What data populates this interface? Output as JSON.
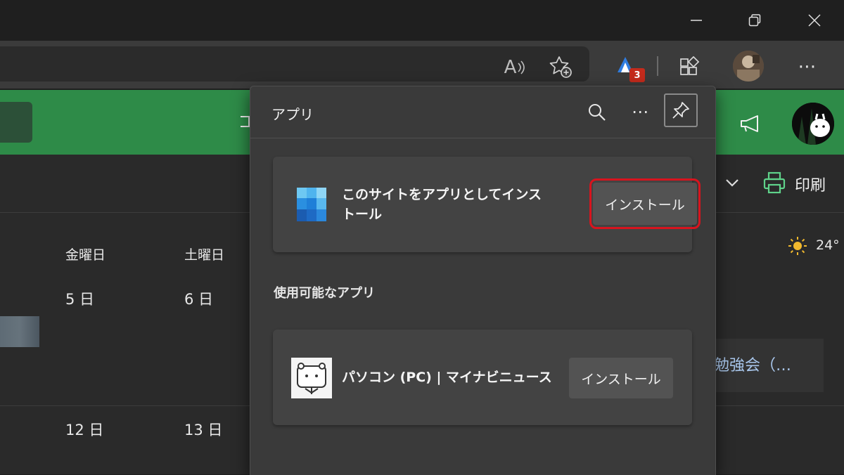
{
  "titlebar": {
    "minimize_icon": "minimize-icon",
    "restore_icon": "restore-icon",
    "close_icon": "close-icon"
  },
  "toolbar": {
    "read_aloud_label": "A",
    "extension_badge_count": "3",
    "more_label": "⋯"
  },
  "page": {
    "print_label": "印刷",
    "days": [
      "金曜日",
      "土曜日"
    ],
    "dates_row1": [
      "5 日",
      "6 日"
    ],
    "dates_row2": [
      "12 日",
      "13 日"
    ],
    "weather_temp": "24°",
    "event_text": "勉強会（…"
  },
  "panel": {
    "title": "アプリ",
    "more_label": "⋯",
    "install_site_text_line1": "このサイトをアプリとしてインス",
    "install_site_text_line2": "トール",
    "install_button_label": "インストール",
    "available_apps_label": "使用可能なアプリ",
    "app_name": "パソコン (PC) | マイナビニュース",
    "app_install_button_label": "インストール"
  },
  "colors": {
    "accent_green": "#2e8b48",
    "highlight_red": "#d8141e",
    "badge_red": "#c42b1c"
  }
}
